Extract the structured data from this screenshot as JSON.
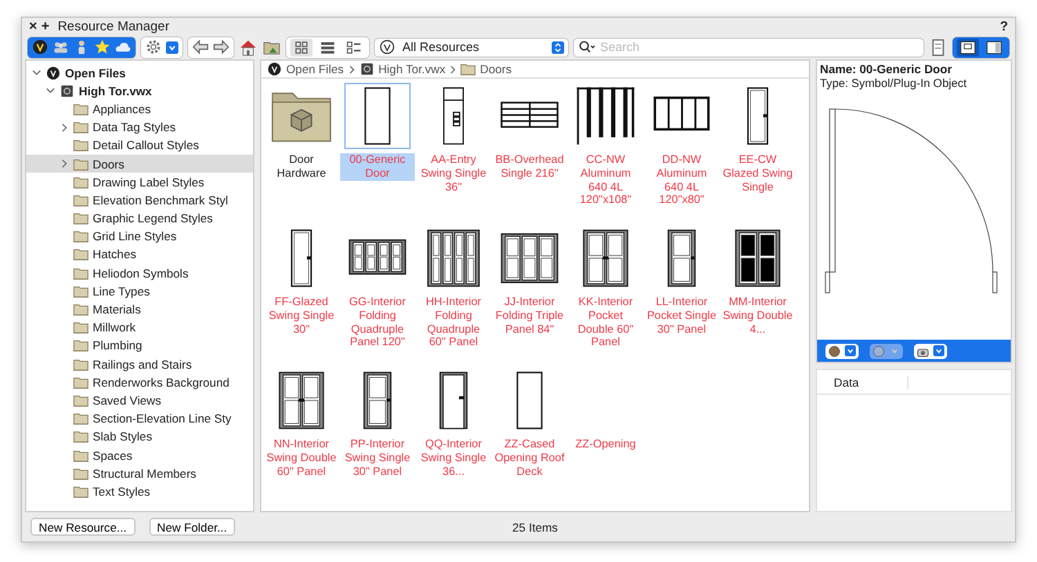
{
  "window": {
    "close_glyph": "×",
    "add_glyph": "+",
    "title": "Resource Manager",
    "help": "?"
  },
  "toolbar": {
    "library_buttons": [
      {
        "kind": "logo"
      },
      {
        "kind": "people"
      },
      {
        "kind": "person"
      },
      {
        "kind": "star"
      },
      {
        "kind": "cloud"
      }
    ],
    "view_buttons": [
      {
        "kind": "grid",
        "selected": true
      },
      {
        "kind": "list",
        "selected": false
      },
      {
        "kind": "detail",
        "selected": false
      }
    ],
    "filter": {
      "value": "All Resources"
    },
    "search": {
      "placeholder": "Search"
    },
    "pane_buttons": [
      {
        "kind": "bottom",
        "selected": true
      },
      {
        "kind": "right",
        "selected": false
      }
    ]
  },
  "tree": [
    {
      "label": "Open Files",
      "kind": "root",
      "expanded": true,
      "children": [
        {
          "label": "High Tor.vwx",
          "kind": "file",
          "expanded": true,
          "children": [
            {
              "label": "Appliances",
              "expandable": false,
              "selected": false
            },
            {
              "label": "Data Tag Styles",
              "expandable": true,
              "selected": false
            },
            {
              "label": "Detail Callout Styles",
              "expandable": false,
              "selected": false
            },
            {
              "label": "Doors",
              "expandable": true,
              "selected": true
            },
            {
              "label": "Drawing Label Styles",
              "expandable": false,
              "selected": false
            },
            {
              "label": "Elevation Benchmark Styl",
              "expandable": false,
              "selected": false
            },
            {
              "label": "Graphic Legend Styles",
              "expandable": false,
              "selected": false
            },
            {
              "label": "Grid Line Styles",
              "expandable": false,
              "selected": false
            },
            {
              "label": "Hatches",
              "expandable": false,
              "selected": false
            },
            {
              "label": "Heliodon Symbols",
              "expandable": false,
              "selected": false
            },
            {
              "label": "Line Types",
              "expandable": false,
              "selected": false
            },
            {
              "label": "Materials",
              "expandable": false,
              "selected": false
            },
            {
              "label": "Millwork",
              "expandable": false,
              "selected": false
            },
            {
              "label": "Plumbing",
              "expandable": false,
              "selected": false
            },
            {
              "label": "Railings and Stairs",
              "expandable": false,
              "selected": false
            },
            {
              "label": "Renderworks Background",
              "expandable": false,
              "selected": false
            },
            {
              "label": "Saved Views",
              "expandable": false,
              "selected": false
            },
            {
              "label": "Section-Elevation Line Sty",
              "expandable": false,
              "selected": false
            },
            {
              "label": "Slab Styles",
              "expandable": false,
              "selected": false
            },
            {
              "label": "Spaces",
              "expandable": false,
              "selected": false
            },
            {
              "label": "Structural Members",
              "expandable": false,
              "selected": false
            },
            {
              "label": "Text Styles",
              "expandable": false,
              "selected": false
            }
          ]
        }
      ]
    }
  ],
  "breadcrumb": [
    {
      "kind": "root",
      "label": "Open Files"
    },
    {
      "kind": "file",
      "label": "High Tor.vwx"
    },
    {
      "kind": "folder",
      "label": "Doors"
    }
  ],
  "items": [
    {
      "label": "Door Hardware",
      "kind": "folder",
      "selected": false
    },
    {
      "label": "00-Generic Door",
      "kind": "plain",
      "selected": true
    },
    {
      "label": "AA-Entry Swing Single 36\"",
      "kind": "entry",
      "selected": false
    },
    {
      "label": "BB-Overhead Single 216\"",
      "kind": "overhead",
      "selected": false
    },
    {
      "label": "CC-NW Aluminum 640 4L 120\"x108\"",
      "kind": "bifold",
      "selected": false
    },
    {
      "label": "DD-NW Aluminum 640 4L 120\"x80\"",
      "kind": "slider",
      "selected": false
    },
    {
      "label": "EE-CW Glazed Swing Single",
      "kind": "glazed",
      "selected": false
    },
    {
      "label": "FF-Glazed Swing Single 30\"",
      "kind": "glazed",
      "selected": false
    },
    {
      "label": "GG-Interior Folding Quadruple Panel 120\"",
      "kind": "quadfold",
      "selected": false
    },
    {
      "label": "HH-Interior Folding Quadruple 60\" Panel",
      "kind": "tallfold",
      "selected": false
    },
    {
      "label": "JJ-Interior Folding Triple Panel 84\"",
      "kind": "triplefold",
      "selected": false
    },
    {
      "label": "KK-Interior Pocket Double 60\" Panel",
      "kind": "double",
      "selected": false
    },
    {
      "label": "LL-Interior Pocket Single 30\" Panel",
      "kind": "panel",
      "selected": false
    },
    {
      "label": "MM-Interior Swing Double 4...",
      "kind": "darkdouble",
      "selected": false
    },
    {
      "label": "NN-Interior Swing Double 60\" Panel",
      "kind": "double",
      "selected": false
    },
    {
      "label": "PP-Interior Swing Single 30\" Panel",
      "kind": "panel",
      "selected": false
    },
    {
      "label": "QQ-Interior Swing Single 36...",
      "kind": "frame",
      "selected": false
    },
    {
      "label": "ZZ-Cased Opening Roof Deck",
      "kind": "plain",
      "selected": false
    },
    {
      "label": "ZZ-Opening",
      "kind": "blank",
      "selected": false
    }
  ],
  "preview": {
    "name": "Name: 00-Generic Door",
    "type": "Type: Symbol/Plug-In Object",
    "controls": [
      {
        "kind": "render",
        "disabled": false
      },
      {
        "kind": "view",
        "disabled": true
      },
      {
        "kind": "camera",
        "disabled": false
      }
    ]
  },
  "data_table": {
    "columns": [
      "Data"
    ]
  },
  "footer": {
    "buttons": [
      "New Resource...",
      "New Folder..."
    ],
    "status": "25 Items"
  }
}
